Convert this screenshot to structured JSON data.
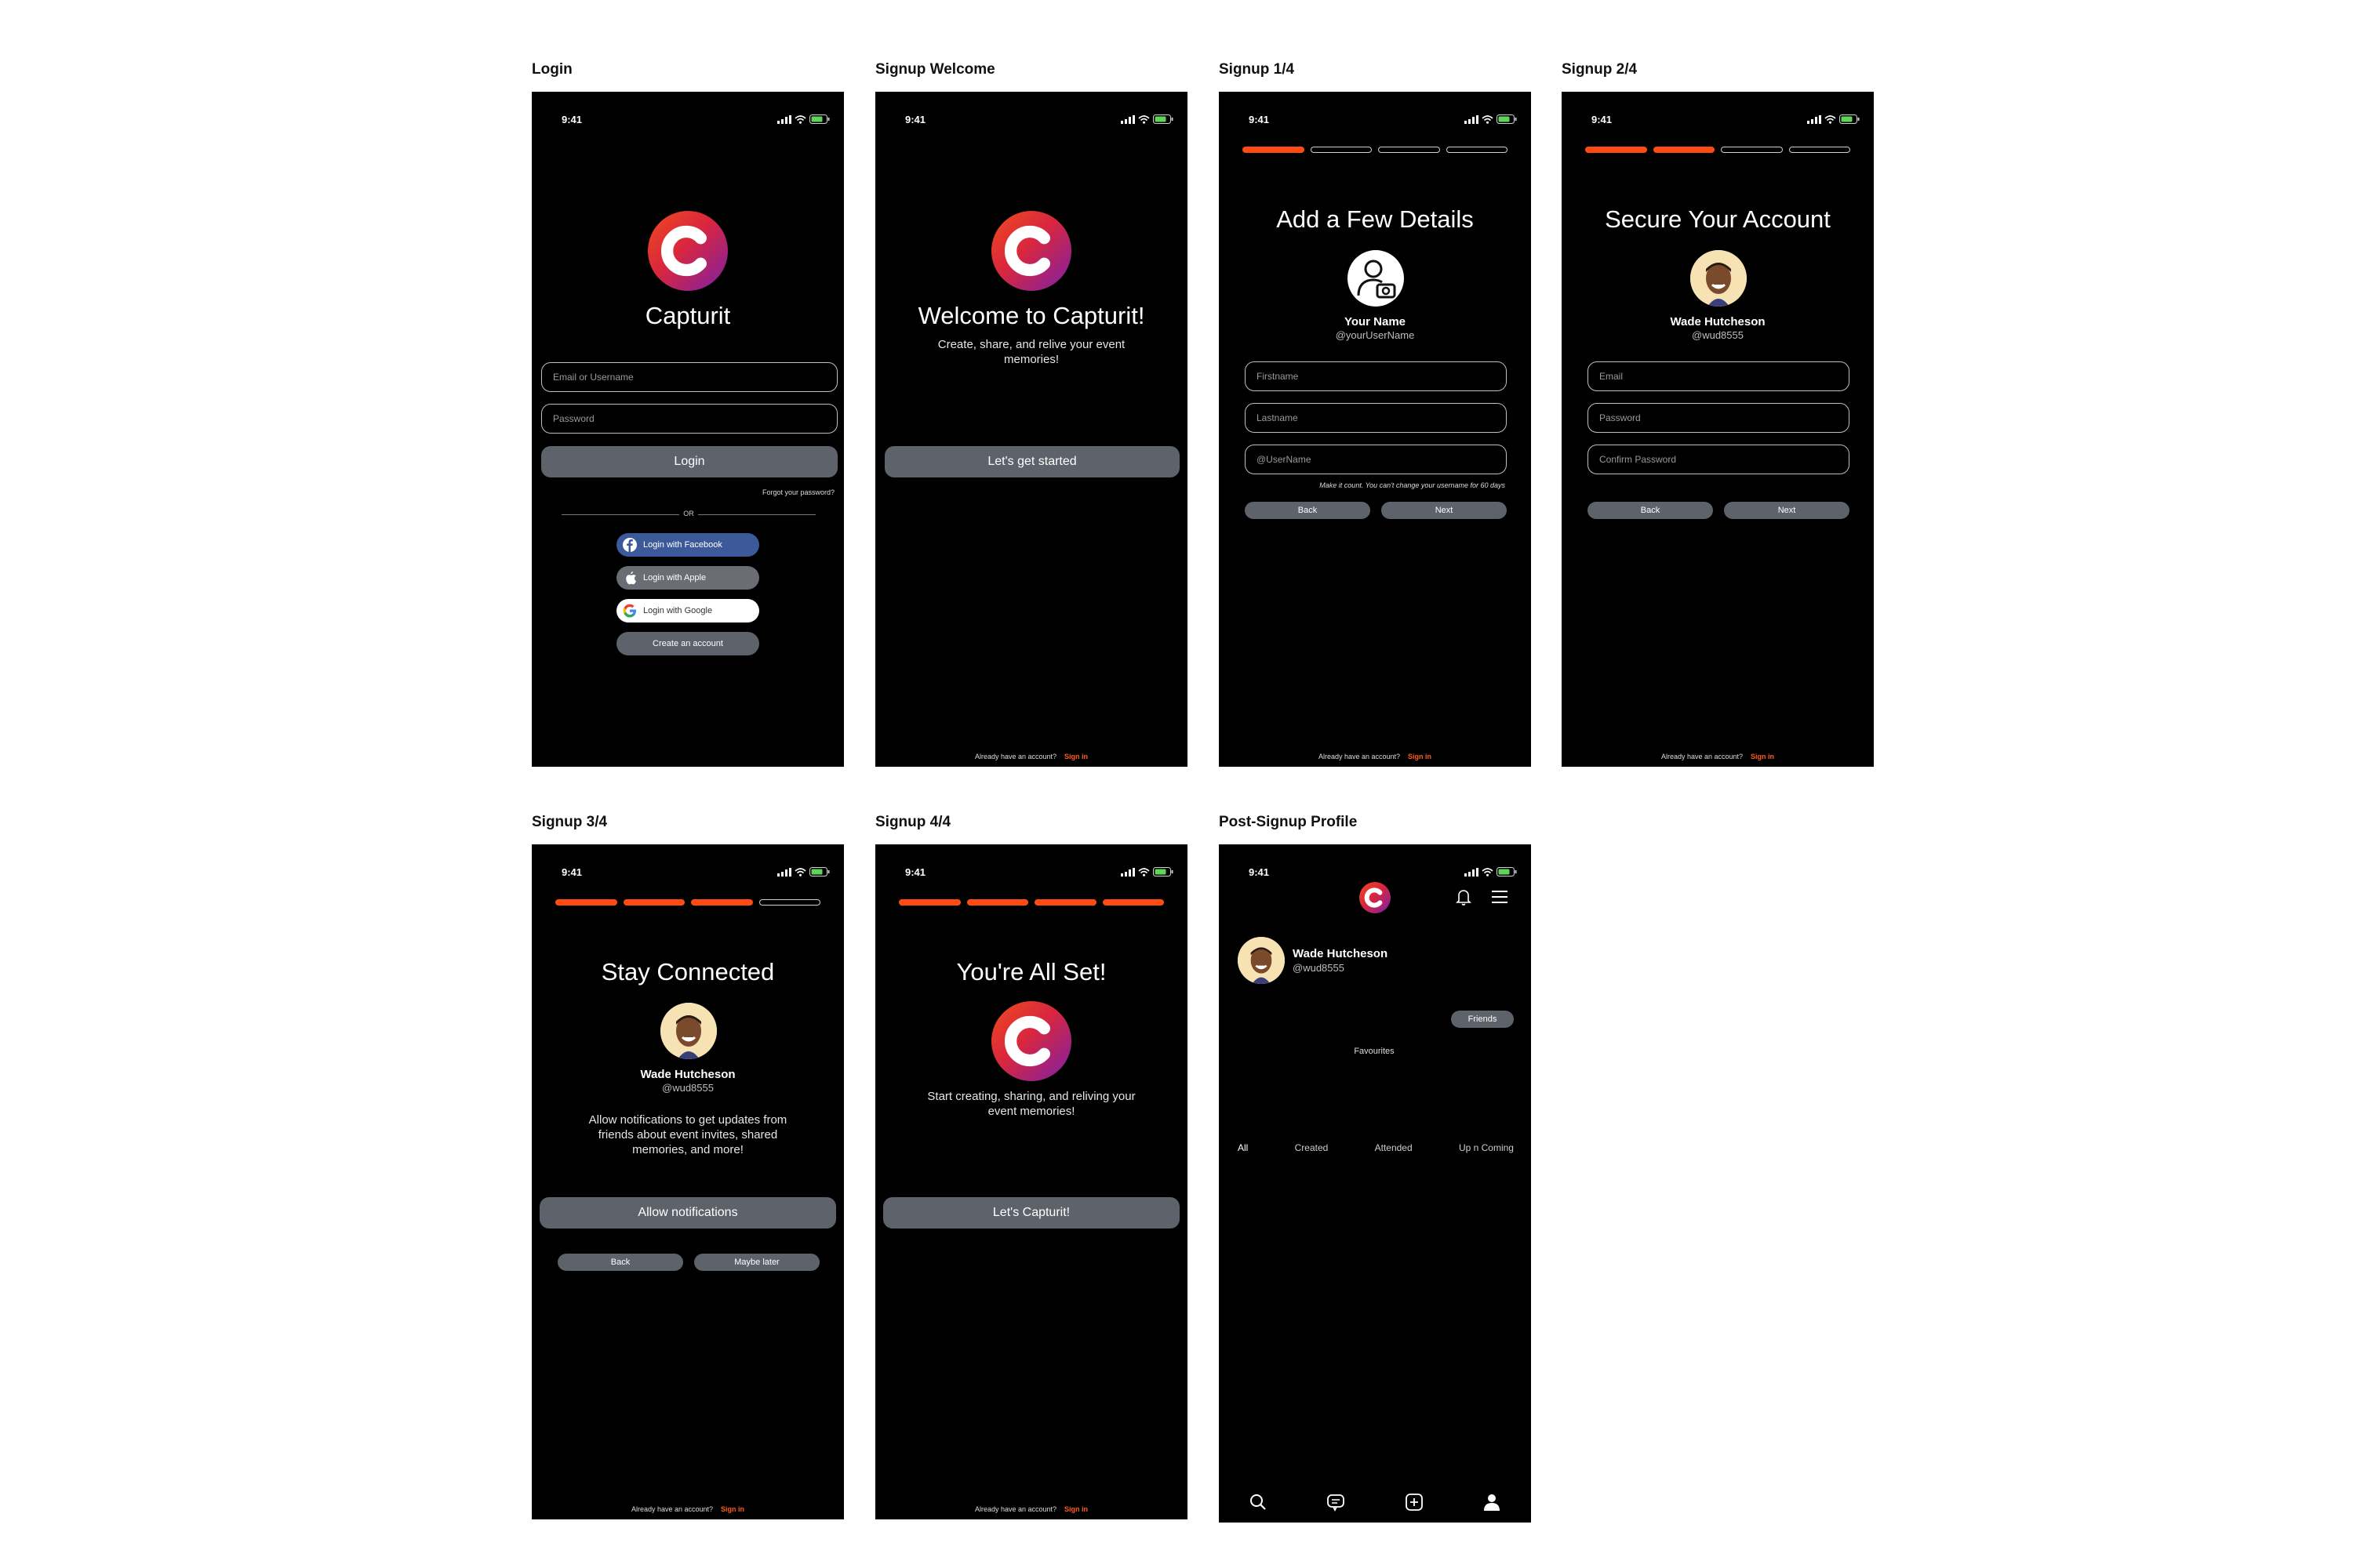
{
  "labels": {
    "login": "Login",
    "welcome": "Signup Welcome",
    "s1": "Signup 1/4",
    "s2": "Signup 2/4",
    "s3": "Signup 3/4",
    "s4": "Signup 4/4",
    "profile": "Post-Signup Profile"
  },
  "status": {
    "time": "9:41"
  },
  "footer": {
    "text": "Already have an account?",
    "link": "Sign in"
  },
  "login": {
    "app_name": "Capturit",
    "email_placeholder": "Email or Username",
    "password_placeholder": "Password",
    "login_button": "Login",
    "forgot": "Forgot your password?",
    "or": "OR",
    "facebook": "Login with Facebook",
    "apple": "Login with Apple",
    "google": "Login with Google",
    "create": "Create an account"
  },
  "welcome": {
    "title": "Welcome to Capturit!",
    "subtitle": "Create, share, and relive your event memories!",
    "button": "Let's get started"
  },
  "signup1": {
    "title": "Add a Few Details",
    "name": "Your Name",
    "handle": "@yourUserName",
    "firstname": "Firstname",
    "lastname": "Lastname",
    "username": "@UserName",
    "hint": "Make it count. You can't change your username for 60 days",
    "back": "Back",
    "next": "Next"
  },
  "signup2": {
    "title": "Secure Your Account",
    "name": "Wade Hutcheson",
    "handle": "@wud8555",
    "email": "Email",
    "password": "Password",
    "confirm": "Confirm Password",
    "back": "Back",
    "next": "Next"
  },
  "signup3": {
    "title": "Stay Connected",
    "name": "Wade Hutcheson",
    "handle": "@wud8555",
    "body": "Allow notifications to get updates from friends about event invites, shared memories, and more!",
    "allow": "Allow notifications",
    "back": "Back",
    "later": "Maybe later"
  },
  "signup4": {
    "title": "You're All Set!",
    "body": "Start creating, sharing, and reliving your event memories!",
    "button": "Let's Capturit!"
  },
  "profile": {
    "name": "Wade Hutcheson",
    "handle": "@wud8555",
    "friends": "Friends",
    "favourites": "Favourites",
    "tabs": [
      "All",
      "Created",
      "Attended",
      "Up n Coming"
    ]
  },
  "colors": {
    "accent": "#ff4b12",
    "button": "#5d626b",
    "facebook": "#3c5a9a"
  },
  "icons": [
    "signal-icon",
    "wifi-icon",
    "battery-icon",
    "facebook-icon",
    "apple-icon",
    "google-icon",
    "camera-icon",
    "bell-icon",
    "menu-icon",
    "search-icon",
    "chat-icon",
    "add-icon",
    "profile-icon"
  ]
}
